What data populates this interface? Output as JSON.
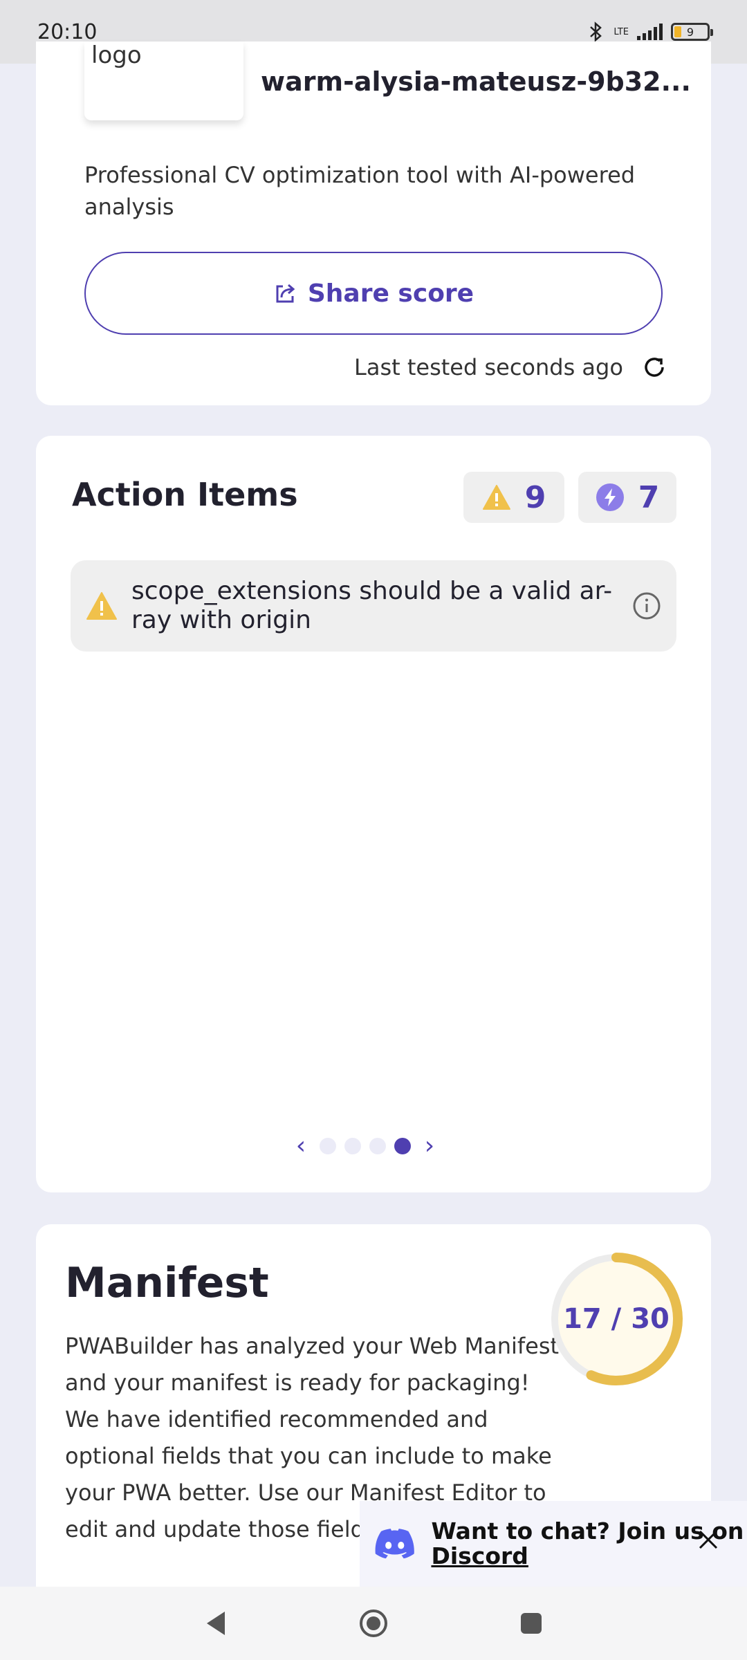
{
  "status_bar": {
    "time": "20:10",
    "network": "LTE",
    "battery": "9"
  },
  "app_card": {
    "logo_label": "logo",
    "site_name": "warm-alysia-mateusz-9b32...",
    "description": "Professional CV optimization tool with AI-powered analysis",
    "share_label": "Share score",
    "last_tested": "Last tested seconds ago"
  },
  "action_items": {
    "title": "Action Items",
    "warnings_count": "9",
    "enhancements_count": "7",
    "items": [
      {
        "text": "scope_extensions should be a valid ar-ray with origin"
      }
    ],
    "pages": 4,
    "active_page": 4
  },
  "manifest": {
    "title": "Manifest",
    "description": "PWABuilder has analyzed your Web Manifest and your manifest is ready for packaging! We have identified recommended and optional fields that you can include to make your PWA better. Use our Manifest Editor to edit and update those fields.",
    "score_label": "17 / 30",
    "score_fraction": 0.567
  },
  "discord_banner": {
    "text_prefix": "Want to chat? Join us on ",
    "link_text": "Discord"
  },
  "colors": {
    "accent": "#4f3fb0",
    "warning": "#f0c14b",
    "score_ring": "#e8bd4e"
  }
}
